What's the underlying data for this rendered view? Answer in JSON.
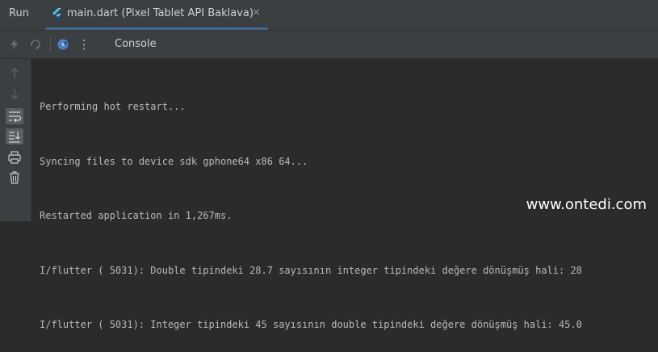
{
  "tabbar": {
    "run_label": "Run",
    "tab_title": "main.dart (Pixel Tablet API Baklava)",
    "close_glyph": "×"
  },
  "toolbar": {
    "console_label": "Console",
    "more_glyph": "⋮"
  },
  "console": {
    "lines": [
      "Performing hot restart...",
      "Syncing files to device sdk gphone64 x86 64...",
      "Restarted application in 1,267ms.",
      "I/flutter ( 5031): Double tipindeki 28.7 sayısının integer tipindeki değere dönüşmüş hali: 28",
      "I/flutter ( 5031): Integer tipindeki 45 sayısının double tipindeki değere dönüşmüş hali: 45.0"
    ]
  },
  "watermark": "www.ontedi.com",
  "colors": {
    "background": "#2b2b2b",
    "panel": "#3c3f41",
    "accent": "#4a88c7",
    "flutter_blue": "#42a5f5"
  },
  "icons": [
    "flutter-icon",
    "lightning-icon",
    "rerun-icon",
    "devtools-icon",
    "more-icon",
    "arrow-up-icon",
    "arrow-down-icon",
    "soft-wrap-icon",
    "scroll-to-end-icon",
    "print-icon",
    "trash-icon"
  ]
}
